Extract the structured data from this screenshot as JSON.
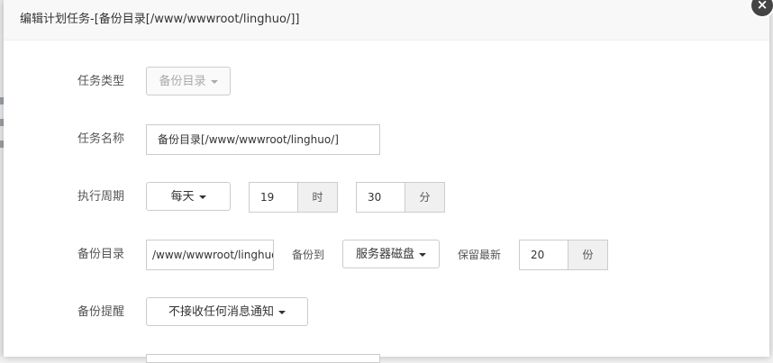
{
  "dialog": {
    "title": "编辑计划任务-[备份目录[/www/wwwroot/linghuo/]]",
    "close_symbol": "×"
  },
  "form": {
    "task_type": {
      "label": "任务类型",
      "value": "备份目录"
    },
    "task_name": {
      "label": "任务名称",
      "value": "备份目录[/www/wwwroot/linghuo/]"
    },
    "period": {
      "label": "执行周期",
      "frequency": "每天",
      "hour": "19",
      "hour_unit": "时",
      "minute": "30",
      "minute_unit": "分"
    },
    "backup_dir": {
      "label": "备份目录",
      "path": "/www/wwwroot/linghuo/",
      "backup_to_label": "备份到",
      "backup_to_value": "服务器磁盘",
      "keep_latest_label": "保留最新",
      "keep_count": "20",
      "keep_unit": "份"
    },
    "notify": {
      "label": "备份提醒",
      "value": "不接收任何消息通知"
    }
  }
}
